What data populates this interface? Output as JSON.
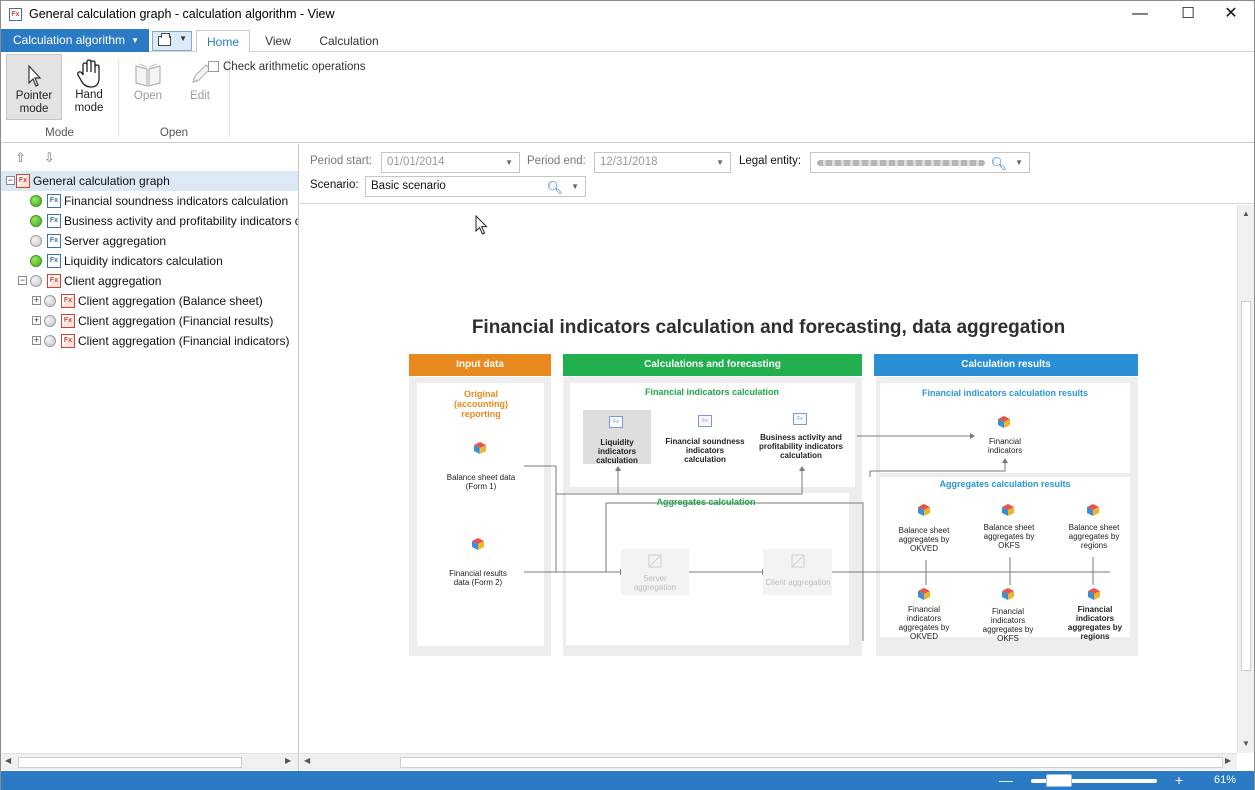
{
  "window": {
    "title": "General calculation graph - calculation algorithm - View",
    "app_icon": "fx-calculation-icon",
    "controls": {
      "minimize": "—",
      "maximize": "☐",
      "close": "✕"
    }
  },
  "ribbon": {
    "app_menu_label": "Calculation algorithm",
    "tabs": [
      {
        "label": "Home",
        "active": true
      },
      {
        "label": "View",
        "active": false
      },
      {
        "label": "Calculation",
        "active": false
      }
    ],
    "groups": {
      "mode": {
        "label": "Mode",
        "buttons": [
          {
            "label_line1": "Pointer",
            "label_line2": "mode",
            "icon": "pointer-icon",
            "selected": true
          },
          {
            "label_line1": "Hand",
            "label_line2": "mode",
            "icon": "hand-icon",
            "selected": false
          }
        ]
      },
      "open": {
        "label": "Open",
        "buttons": [
          {
            "label": "Open",
            "icon": "open-book-icon",
            "enabled": false
          },
          {
            "label": "Edit",
            "icon": "pencil-icon",
            "enabled": false
          }
        ]
      }
    },
    "check_arithmetic_label": "Check arithmetic operations",
    "check_arithmetic_checked": false
  },
  "tree": {
    "root": "General calculation graph",
    "items": [
      {
        "label": "Financial soundness indicators calculation",
        "status": "green"
      },
      {
        "label": "Business activity and profitability indicators calculation",
        "status": "green"
      },
      {
        "label": "Server aggregation",
        "status": "gray"
      },
      {
        "label": "Liquidity indicators calculation",
        "status": "green"
      },
      {
        "label": "Client aggregation",
        "status": "gray"
      },
      {
        "label": "Client aggregation (Balance sheet)",
        "status": "gray"
      },
      {
        "label": "Client aggregation (Financial results)",
        "status": "gray"
      },
      {
        "label": "Client aggregation (Financial indicators)",
        "status": "gray"
      }
    ],
    "tree_expander_minus": "−",
    "tree_expander_plus": "+"
  },
  "filters": {
    "period_start_label": "Period start:",
    "period_start_value": "01/01/2014",
    "period_end_label": "Period end:",
    "period_end_value": "12/31/2018",
    "legal_entity_label": "Legal entity:",
    "scenario_label": "Scenario:",
    "scenario_value": "Basic scenario"
  },
  "diagram": {
    "title": "Financial indicators calculation and forecasting, data aggregation",
    "columns": [
      {
        "header": "Input data",
        "color": "#e8891d"
      },
      {
        "header": "Calculations and forecasting",
        "color": "#22b04e"
      },
      {
        "header": "Calculation results",
        "color": "#2a8fd4"
      }
    ],
    "input": {
      "original_label": "Original (accounting) reporting",
      "balance_label": "Balance sheet data (Form 1)",
      "financial_label": "Financial results data (Form 2)"
    },
    "calc": {
      "financial_indicators_label": "Financial indicators calculation",
      "liquidity": "Liquidity indicators calculation",
      "soundness": "Financial soundness indicators calculation",
      "business": "Business activity and profitability indicators calculation",
      "aggregates_label": "Aggregates calculation",
      "server": "Server aggregation",
      "client": "Client aggregation"
    },
    "results": {
      "fi_results_label": "Financial indicators calculation results",
      "financial_indicators": "Financial indicators",
      "agg_results_label": "Aggregates calculation results",
      "bs_okved": "Balance sheet aggregates by OKVED",
      "bs_okfs": "Balance sheet aggregates by OKFS",
      "bs_regions": "Balance sheet aggregates by regions",
      "fi_okved": "Financial indicators aggregates by OKVED",
      "fi_okfs": "Financial indicators aggregates by OKFS",
      "fi_regions": "Financial indicators aggregates by regions"
    }
  },
  "status": {
    "zoom_minus": "—",
    "zoom_plus": "+",
    "zoom_value": "61%",
    "zoom_level": 0.61
  }
}
